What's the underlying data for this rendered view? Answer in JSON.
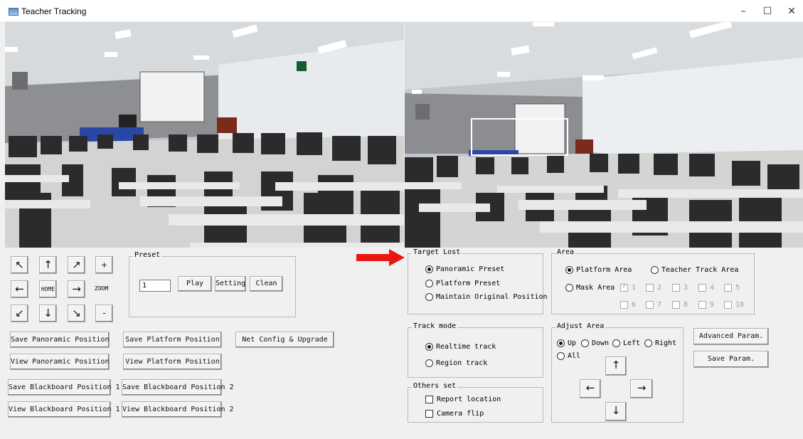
{
  "window": {
    "title": "Teacher Tracking",
    "controls": {
      "minimize": "–",
      "maximize": "☐",
      "close": "✕"
    }
  },
  "ptz": {
    "up_left": "↖",
    "up": "↑",
    "up_right": "↗",
    "zoom_in": "+",
    "left": "←",
    "home": "HOME",
    "right": "→",
    "zoom": "ZOOM",
    "down_left": "↙",
    "down": "↓",
    "down_right": "↘",
    "zoom_out": "-"
  },
  "preset": {
    "title": "Preset",
    "value": "1",
    "play": "Play",
    "setting": "Setting",
    "clean": "Clean"
  },
  "positions": {
    "save_panoramic": "Save Panoramic Position",
    "save_platform": "Save Platform Position",
    "net_config": "Net Config & Upgrade",
    "view_panoramic": "View Panoramic Position",
    "view_platform": "View Platform Position",
    "save_blackboard_1": "Save Blackboard Position 1",
    "save_blackboard_2": "Save Blackboard Position 2",
    "view_blackboard_1": "View Blackboard Position 1",
    "view_blackboard_2": "View Blackboard Position 2"
  },
  "target_lost": {
    "title": "Target Lost",
    "options": [
      "Panoramic Preset",
      "Platform Preset",
      "Maintain Original Position"
    ],
    "selected": "Panoramic Preset"
  },
  "area": {
    "title": "Area",
    "platform_area": "Platform Area",
    "teacher_track_area": "Teacher Track Area",
    "mask_area": "Mask Area",
    "selected": "Platform Area",
    "mask_checks": [
      "1",
      "2",
      "3",
      "4",
      "5",
      "6",
      "7",
      "8",
      "9",
      "10"
    ],
    "mask_checked": [
      "1"
    ]
  },
  "track_mode": {
    "title": "Track mode",
    "options": [
      "Realtime track",
      "Region track"
    ],
    "selected": "Realtime track"
  },
  "adjust_area": {
    "title": "Adjust Area",
    "options": [
      "Up",
      "Down",
      "Left",
      "Right",
      "All"
    ],
    "selected": "Up",
    "arrow_up": "↑",
    "arrow_left": "←",
    "arrow_right": "→",
    "arrow_down": "↓"
  },
  "others_set": {
    "title": "Others set",
    "report_location": "Report location",
    "camera_flip": "Camera flip"
  },
  "params": {
    "advanced": "Advanced Param.",
    "save": "Save Param."
  },
  "colors": {
    "indicator_arrow": "#e8170f",
    "window_bg": "#f0f0f0"
  }
}
